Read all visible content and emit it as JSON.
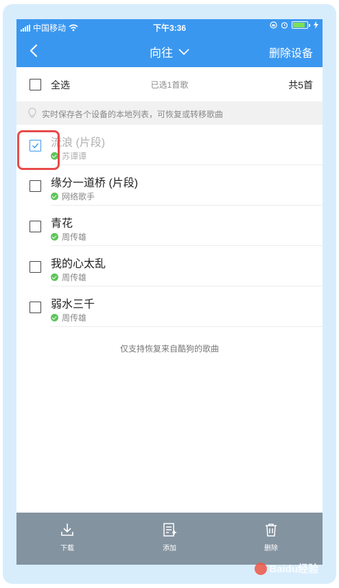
{
  "statusbar": {
    "carrier": "中国移动",
    "time": "下午3:36"
  },
  "navbar": {
    "title": "向往",
    "action": "删除设备"
  },
  "selectbar": {
    "select_all": "全选",
    "selected_count": "已选1首歌",
    "total": "共5首"
  },
  "hint": {
    "text": "实时保存各个设备的本地列表，可恢复或转移歌曲"
  },
  "songs": [
    {
      "title": "流浪 (片段)",
      "artist": "苏谭谭",
      "checked": true
    },
    {
      "title": "缘分一道桥 (片段)",
      "artist": "网络歌手",
      "checked": false
    },
    {
      "title": "青花",
      "artist": "周传雄",
      "checked": false
    },
    {
      "title": "我的心太乱",
      "artist": "周传雄",
      "checked": false
    },
    {
      "title": "弱水三千",
      "artist": "周传雄",
      "checked": false
    }
  ],
  "footnote": "仅支持恢复来自酷狗的歌曲",
  "toolbar": {
    "download": "下载",
    "add": "添加",
    "delete": "删除"
  },
  "watermark": "Baidu经验",
  "colors": {
    "accent": "#3a97f0",
    "highlight": "#e84a4a",
    "toolbar": "#8493a0",
    "status_ok": "#5ec45a"
  }
}
